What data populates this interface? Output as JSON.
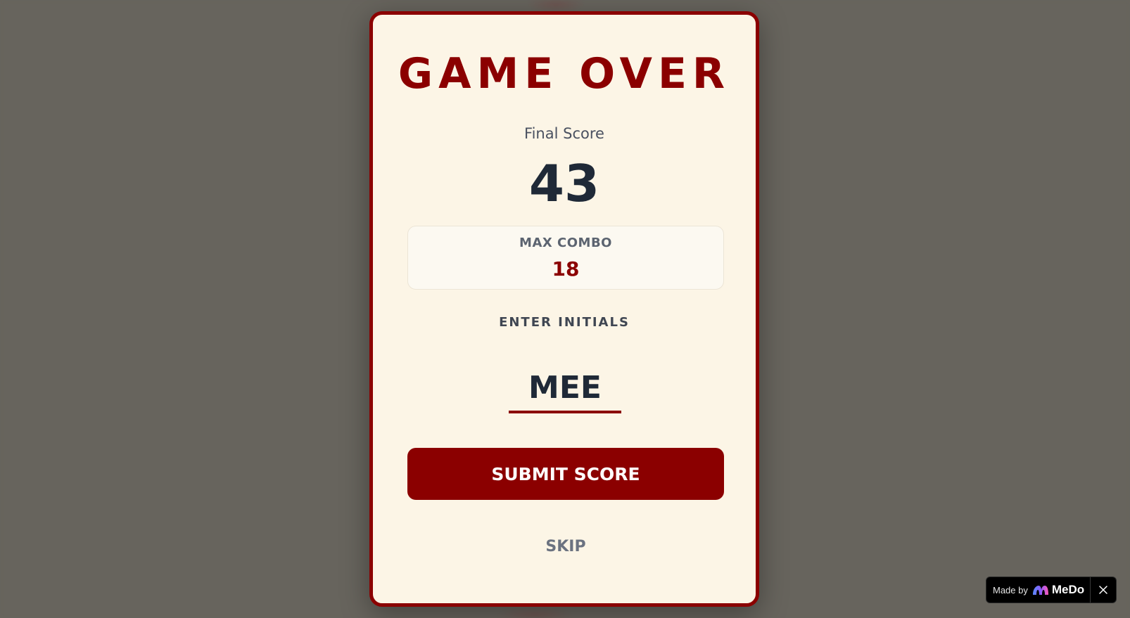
{
  "modal": {
    "title": "GAME OVER",
    "final_score_label": "Final Score",
    "final_score": "43",
    "max_combo_label": "MAX COMBO",
    "max_combo": "18",
    "initials_label": "ENTER INITIALS",
    "initials_value": "MEE",
    "submit_label": "SUBMIT SCORE",
    "skip_label": "SKIP"
  },
  "badge": {
    "made_by": "Made by",
    "brand": "MeDo",
    "logo_icon": "medo-logo-icon",
    "close_icon": "close-icon"
  },
  "colors": {
    "accent": "#8b0000",
    "panel_bg": "#fcf5e6",
    "overlay_bg": "#67645d",
    "score_text": "#1f2937"
  }
}
